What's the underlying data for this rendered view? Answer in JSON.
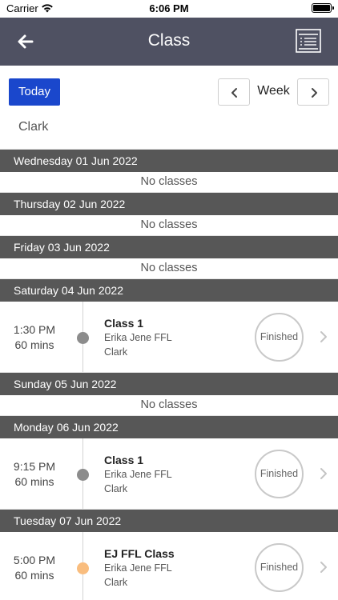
{
  "status_bar": {
    "carrier": "Carrier",
    "time": "6:06 PM"
  },
  "nav": {
    "title": "Class"
  },
  "controls": {
    "today_label": "Today",
    "week_label": "Week",
    "filter_name": "Clark"
  },
  "days": [
    {
      "header": "Wednesday 01 Jun 2022",
      "empty_text": "No classes"
    },
    {
      "header": "Thursday 02 Jun 2022",
      "empty_text": "No classes"
    },
    {
      "header": "Friday 03 Jun 2022",
      "empty_text": "No classes"
    },
    {
      "header": "Saturday 04 Jun 2022",
      "class": {
        "time": "1:30 PM",
        "duration": "60 mins",
        "name": "Class 1",
        "instructor": "Erika Jene FFL",
        "location": "Clark",
        "status": "Finished",
        "dot_color": "#8c8c8c"
      }
    },
    {
      "header": "Sunday 05 Jun 2022",
      "empty_text": "No classes"
    },
    {
      "header": "Monday 06 Jun 2022",
      "class": {
        "time": "9:15 PM",
        "duration": "60 mins",
        "name": "Class 1",
        "instructor": "Erika Jene FFL",
        "location": "Clark",
        "status": "Finished",
        "dot_color": "#8c8c8c"
      }
    },
    {
      "header": "Tuesday 07 Jun 2022",
      "class": {
        "time": "5:00 PM",
        "duration": "60 mins",
        "name": "EJ FFL Class",
        "instructor": "Erika Jene FFL",
        "location": "Clark",
        "status": "Finished",
        "dot_color": "#f9bd7e"
      }
    }
  ],
  "colors": {
    "nav_bg": "#4f5162",
    "today_button": "#1a47cc",
    "day_header_bg": "#575757"
  }
}
